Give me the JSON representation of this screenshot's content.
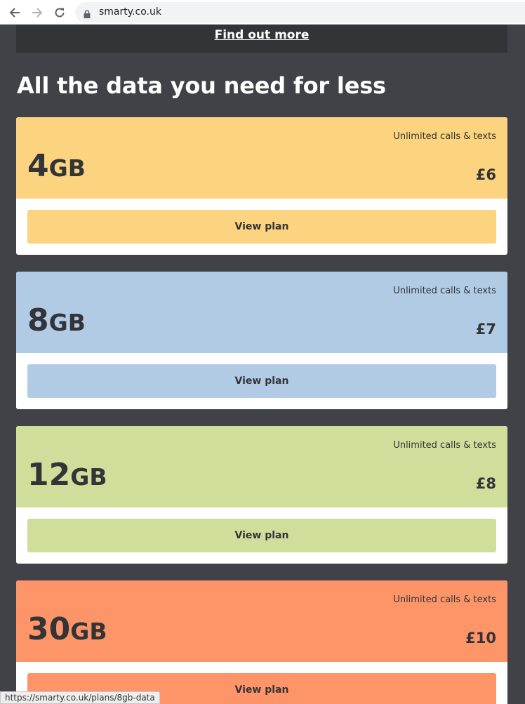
{
  "browser": {
    "url": "smarty.co.uk"
  },
  "promo": {
    "link_label": "Find out more"
  },
  "heading": "All the data you need for less",
  "plans": [
    {
      "amount": "4",
      "unit": "GB",
      "calls": "Unlimited calls & texts",
      "price": "£6",
      "button": "View plan",
      "color": "#fcd37e"
    },
    {
      "amount": "8",
      "unit": "GB",
      "calls": "Unlimited calls & texts",
      "price": "£7",
      "button": "View plan",
      "color": "#b1cbe4"
    },
    {
      "amount": "12",
      "unit": "GB",
      "calls": "Unlimited calls & texts",
      "price": "£8",
      "button": "View plan",
      "color": "#cfde9b"
    },
    {
      "amount": "30",
      "unit": "GB",
      "calls": "Unlimited calls & texts",
      "price": "£10",
      "button": "View plan",
      "color": "#fe9569"
    }
  ],
  "status_bar": {
    "link_url": "https://smarty.co.uk/plans/8gb-data"
  },
  "colors": {
    "page_background": "#404247",
    "promo_background": "#333438",
    "text_dark": "#333438"
  }
}
